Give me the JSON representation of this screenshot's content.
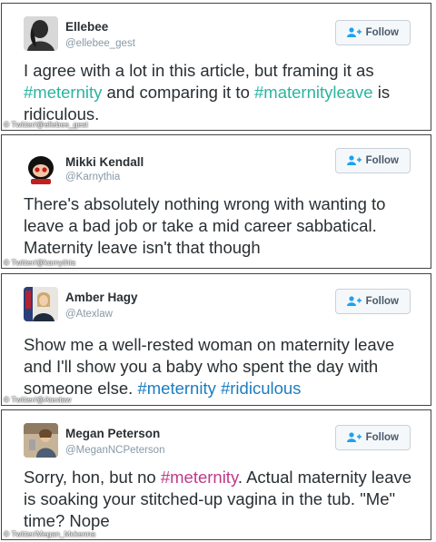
{
  "follow_label": "Follow",
  "tweets": [
    {
      "name": "Ellebee",
      "handle": "@ellebee_gest",
      "text_parts": [
        "I agree with a lot in this article, but framing it as ",
        "#meternity",
        " and comparing it to ",
        "#maternityleave",
        " is ridiculous."
      ],
      "credit": "© Twitter/@ellebee_gest"
    },
    {
      "name": "Mikki Kendall",
      "handle": "@Karnythia",
      "text_parts": [
        "There's absolutely nothing wrong with wanting to leave a bad job or take a mid career sabbatical. Maternity leave isn't that though"
      ],
      "credit": "© Twitter/@karnythia"
    },
    {
      "name": "Amber Hagy",
      "handle": "@Atexlaw",
      "text_parts": [
        "Show me a well-rested woman on maternity leave and I'll show you a baby who spent the day with someone else. ",
        "#meternity",
        " ",
        "#ridiculous"
      ],
      "credit": "© Twitter/@Atexlaw"
    },
    {
      "name": "Megan Peterson",
      "handle": "@MeganNCPeterson",
      "text_parts": [
        "Sorry, hon, but no ",
        "#meternity",
        ". Actual maternity leave is soaking your stitched-up vagina in the tub. \"Me\" time? Nope"
      ],
      "credit": "© Twitter/Megan_Mckenna"
    }
  ],
  "colors": {
    "hashtag_teal": "#2ab5a0",
    "hashtag_blue": "#1b7dc0",
    "hashtag_pink": "#c0398a"
  }
}
